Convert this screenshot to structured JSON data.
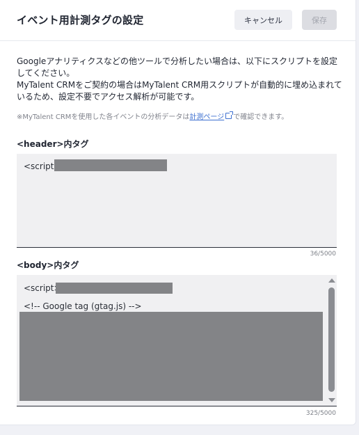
{
  "dialog": {
    "title": "イベント用計測タグの設定",
    "cancel_label": "キャンセル",
    "save_label": "保存"
  },
  "description": {
    "line1": "Googleアナリティクスなどの他ツールで分析したい場合は、以下にスクリプトを設定してください。",
    "line2": "MyTalent CRMをご契約の場合はMyTalent CRM用スクリプトが自動的に埋め込まれているため、設定不要でアクセス解析が可能です。",
    "note_prefix": "※MyTalent CRMを使用した各イベントの分析データは",
    "note_link": "計測ページ",
    "note_suffix": "で確認できます。"
  },
  "header_tag": {
    "label": "<header>内タグ",
    "code_start": "<script>",
    "counter": "36/5000"
  },
  "body_tag": {
    "label": "<body>内タグ",
    "code_start": "<script>",
    "code_line2": "<!-- Google tag (gtag.js) -->",
    "counter": "325/5000"
  },
  "colors": {
    "link": "#3c6fd0",
    "redaction": "#838487",
    "save_disabled_bg": "#dcdde2"
  },
  "icons": [
    "external-link-icon",
    "scroll-up-arrow-icon",
    "scroll-down-arrow-icon"
  ]
}
